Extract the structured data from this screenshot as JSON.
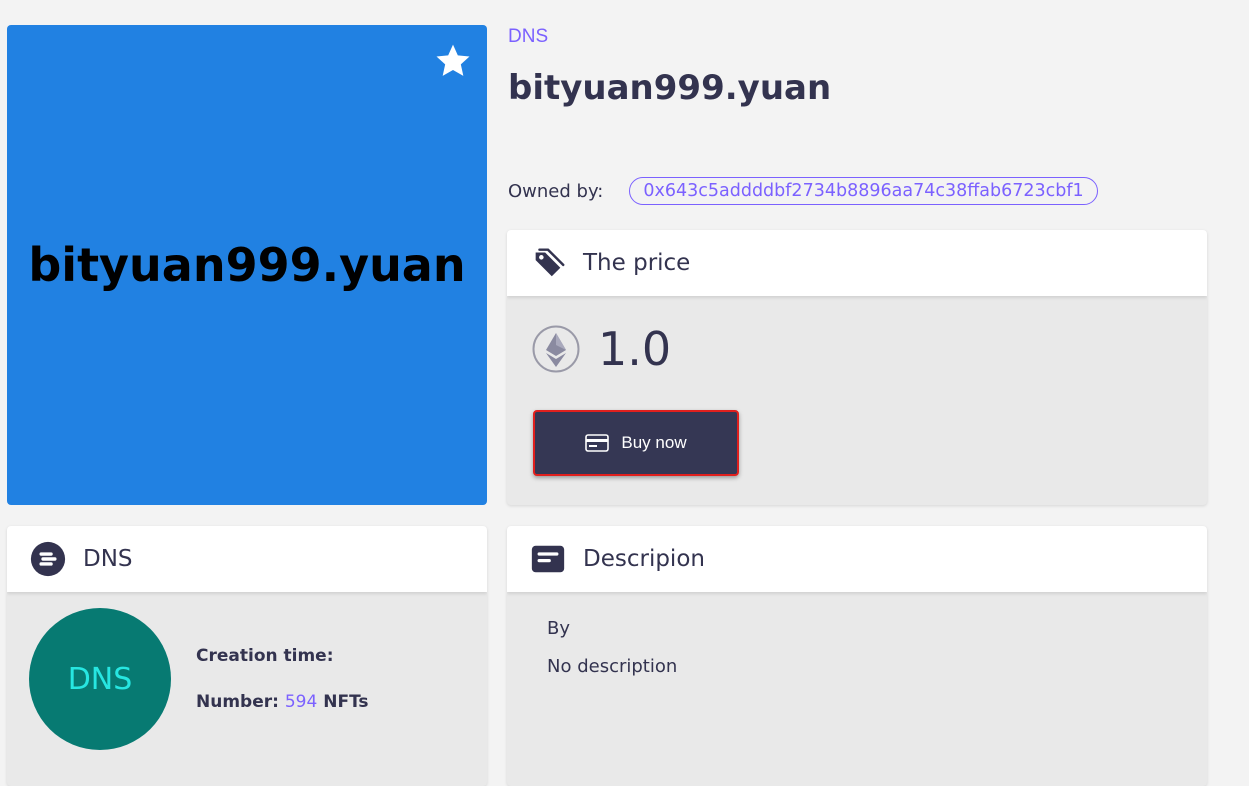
{
  "nft": {
    "image_text": "bityuan999.yuan",
    "image_color": "#2181e2",
    "collection": "DNS",
    "title": "bityuan999.yuan",
    "owner_label": "Owned by:",
    "owner_address": "0x643c5addddbf2734b8896aa74c38ffab6723cbf1"
  },
  "price_card": {
    "title": "The price",
    "title_icon": "price-tag-icon",
    "currency_icon": "ethereum-icon",
    "value": "1.0",
    "buy_label": "Buy now",
    "buy_icon": "credit-card-icon"
  },
  "collection_card": {
    "title": "DNS",
    "title_icon": "collection-logo-icon",
    "avatar_text": "DNS",
    "avatar_color": "#077a72",
    "creation_label": "Creation time:",
    "creation_value": "",
    "number_label": "Number:",
    "number_value": "594",
    "number_unit": "NFTs"
  },
  "description_card": {
    "title": "Descripion",
    "title_icon": "description-icon",
    "by": "By",
    "text": "No description"
  },
  "colors": {
    "accent": "#7b61ff",
    "dark": "#33334f",
    "button": "#353754",
    "highlight_border": "#e0201e"
  }
}
